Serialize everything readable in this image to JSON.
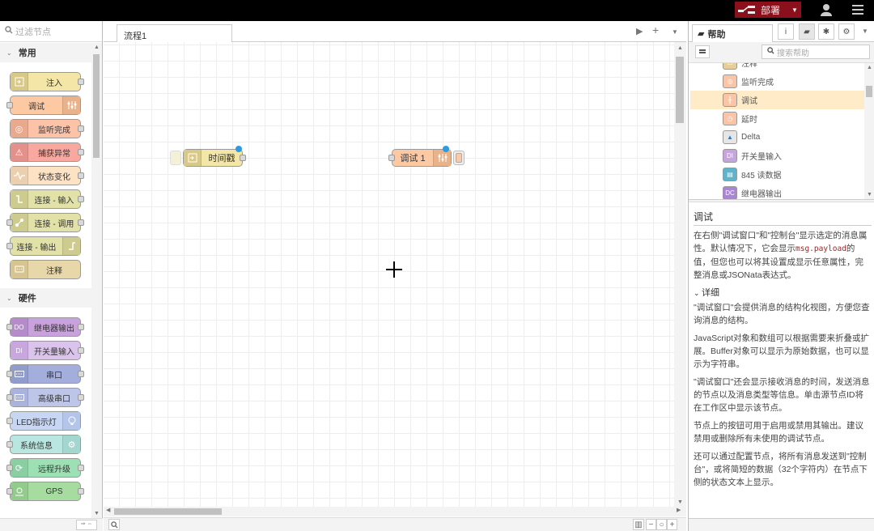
{
  "header": {
    "deploy_label": "部署",
    "colors": {
      "deploy_bg": "#8c101c",
      "header_bg": "#000000"
    }
  },
  "palette": {
    "filter_placeholder": "过滤节点",
    "categories": [
      {
        "name": "常用",
        "nodes": [
          {
            "label": "注入",
            "color": "#e7e7ae",
            "icon": "inject-icon",
            "icon_side": "left",
            "in": false,
            "out": true
          },
          {
            "label": "调试",
            "color": "#87a980",
            "icon": "debug-icon",
            "icon_side": "right",
            "in": true,
            "out": false
          },
          {
            "label": "监听完成",
            "color": "#c0edc0",
            "icon": "complete-icon",
            "icon_side": "left",
            "in": false,
            "out": true
          },
          {
            "label": "捕获异常",
            "color": "#e49191",
            "icon": "alert-icon",
            "icon_side": "left",
            "in": false,
            "out": true
          },
          {
            "label": "状态变化",
            "color": "#94c1d0",
            "icon": "status-icon",
            "icon_side": "left",
            "in": false,
            "out": true
          },
          {
            "label": "连接 - 输入",
            "color": "#ddd",
            "icon": "link-in-icon",
            "icon_side": "left",
            "in": false,
            "out": true
          },
          {
            "label": "连接 - 调用",
            "color": "#ddd",
            "icon": "link-call-icon",
            "icon_side": "left",
            "in": true,
            "out": true
          },
          {
            "label": "连接 - 输出",
            "color": "#ddd",
            "icon": "link-out-icon",
            "icon_side": "right",
            "in": true,
            "out": false
          },
          {
            "label": "注释",
            "color": "#fff",
            "icon": "comment-icon",
            "icon_side": "left",
            "in": false,
            "out": false
          }
        ]
      },
      {
        "name": "硬件",
        "nodes": [
          {
            "label": "继电器输出",
            "icon": "relay-icon",
            "icon_side": "left",
            "in": true,
            "out": true
          },
          {
            "label": "开关量输入",
            "icon": "di-icon",
            "icon_side": "left",
            "in": false,
            "out": true
          },
          {
            "label": "串口",
            "icon": "serial-icon",
            "icon_side": "left",
            "in": true,
            "out": true
          },
          {
            "label": "高级串口",
            "icon": "serial-advanced-icon",
            "icon_side": "left",
            "in": true,
            "out": true
          },
          {
            "label": "LED指示灯",
            "icon": "bulb-icon",
            "icon_side": "right",
            "in": true,
            "out": false
          },
          {
            "label": "系统信息",
            "icon": "gear-icon",
            "icon_side": "right",
            "in": true,
            "out": false
          },
          {
            "label": "远程升级",
            "icon": "upgrade-icon",
            "icon_side": "left",
            "in": true,
            "out": true
          },
          {
            "label": "GPS",
            "icon": "gps-icon",
            "icon_side": "left",
            "in": true,
            "out": true
          }
        ]
      }
    ]
  },
  "workspace": {
    "tabs": [
      {
        "label": "流程1",
        "active": true
      }
    ],
    "nodes": [
      {
        "label": "时间戳",
        "type": "inject",
        "changed": true
      },
      {
        "label": "调试 1",
        "type": "debug",
        "changed": true
      }
    ]
  },
  "sidebar": {
    "active_tab": "帮助",
    "search_placeholder": "搜索帮助",
    "tree": [
      {
        "label": "注释",
        "icon": "comment-icon",
        "color": "#e6cd9a"
      },
      {
        "label": "监听完成",
        "icon": "complete-icon",
        "color": "#f9c5a6"
      },
      {
        "label": "调试",
        "icon": "debug-icon",
        "color": "#f9c5a6",
        "selected": true
      },
      {
        "label": "延时",
        "icon": "clock-icon",
        "color": "#f9c5a6"
      },
      {
        "label": "Delta",
        "icon": "delta-icon",
        "color": "#e6e6e6"
      },
      {
        "label": "开关量输入",
        "icon": "di-icon",
        "color": "#c8a4de"
      },
      {
        "label": "845 读数据",
        "icon": "read-data-icon",
        "color": "#5fb4c9"
      },
      {
        "label": "继电器输出",
        "icon": "relay-icon",
        "color": "#a886d4"
      }
    ],
    "help": {
      "title": "调试",
      "intro_before": "在右侧\"调试窗口\"和\"控制台\"显示选定的消息属性。默认情况下，它会显示",
      "intro_code": "msg.payload",
      "intro_after": "的值，但您也可以将其设置成显示任意属性，完整消息或JSONata表达式。",
      "details_heading": "详细",
      "paragraphs": [
        "\"调试窗口\"会提供消息的结构化视图，方便您查询消息的结构。",
        "JavaScript对象和数组可以根据需要来折叠或扩展。Buffer对象可以显示为原始数据，也可以显示为字符串。",
        "\"调试窗口\"还会显示接收消息的时间，发送消息的节点以及消息类型等信息。单击源节点ID将在工作区中显示该节点。",
        "节点上的按钮可用于启用或禁用其输出。建议禁用或删除所有未使用的调试节点。",
        "还可以通过配置节点，将所有消息发送到\"控制台\"，或将简短的数据（32个字符内）在节点下侧的状态文本上显示。"
      ]
    }
  }
}
